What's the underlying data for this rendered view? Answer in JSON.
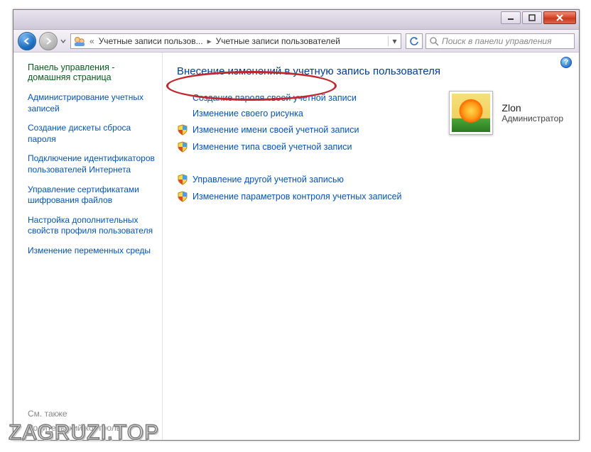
{
  "titlebar": {
    "minimize": "–",
    "close": "×"
  },
  "nav": {
    "breadcrumb_prefix": "«",
    "breadcrumb_seg1": "Учетные записи пользов...",
    "breadcrumb_seg2": "Учетные записи пользователей",
    "search_placeholder": "Поиск в панели управления"
  },
  "sidebar": {
    "home": "Панель управления - домашняя страница",
    "links": [
      "Администрирование учетных записей",
      "Создание дискеты сброса пароля",
      "Подключение идентификаторов пользователей Интернета",
      "Управление сертификатами шифрования файлов",
      "Настройка дополнительных свойств профиля пользователя",
      "Изменение переменных среды"
    ],
    "see_also_label": "См. также",
    "see_also_item": "Родительский контроль"
  },
  "main": {
    "title": "Внесение изменений в учетную запись пользователя",
    "tasks_primary": [
      "Создание пароля своей учетной записи",
      "Изменение своего рисунка",
      "Изменение имени своей учетной записи",
      "Изменение типа своей учетной записи"
    ],
    "tasks_secondary": [
      "Управление другой учетной записью",
      "Изменение параметров контроля учетных записей"
    ],
    "task_shield": [
      false,
      false,
      true,
      true
    ],
    "sec_shield": [
      true,
      true
    ]
  },
  "user": {
    "name": "Zlon",
    "role": "Администратор"
  },
  "watermark": "ZAGRUZI.TOP"
}
